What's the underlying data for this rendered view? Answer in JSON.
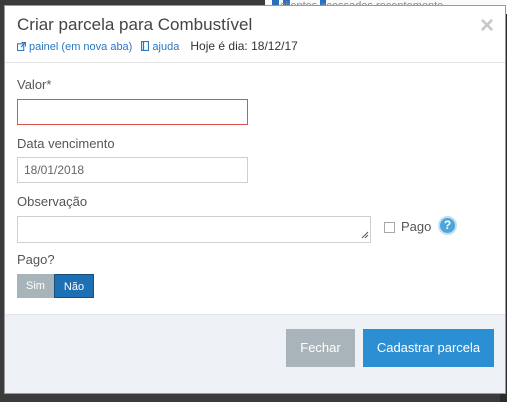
{
  "background": {
    "strip_text": "clientes acessados recentemente..."
  },
  "modal": {
    "title": "Criar parcela para Combustível",
    "links": {
      "painel": "painel (em nova aba)",
      "ajuda": "ajuda"
    },
    "date_text": "Hoje é dia: 18/12/17",
    "close_glyph": "×"
  },
  "form": {
    "valor_label": "Valor*",
    "valor_value": "",
    "data_label": "Data vencimento",
    "data_value": "18/01/2018",
    "obs_label": "Observação",
    "obs_value": "",
    "pago_checkbox_label": "Pago",
    "pago_checked": false,
    "help_glyph": "?",
    "pago_toggle_label": "Pago?",
    "toggle": {
      "sim": "Sim",
      "nao": "Não",
      "selected": "Não"
    }
  },
  "footer": {
    "close_label": "Fechar",
    "submit_label": "Cadastrar parcela"
  },
  "colors": {
    "primary": "#2d8fd3",
    "toggle_active": "#1f6fb4",
    "disabled_gray": "#a9b4ba",
    "error_border": "#d9534f",
    "link": "#2a77c2",
    "help": "#4ea6d8"
  },
  "icons": [
    "external-link-icon",
    "book-icon",
    "close-icon",
    "help-icon",
    "resize-grip-icon"
  ]
}
